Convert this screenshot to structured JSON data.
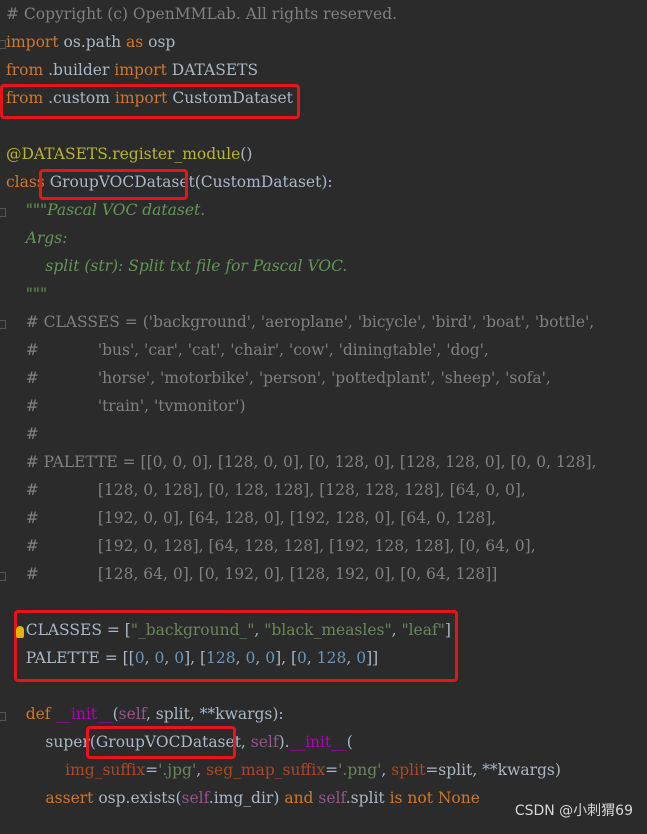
{
  "lines": [
    {
      "segments": [
        {
          "t": "# Copyright (c) OpenMMLab. All rights reserved.",
          "c": "com"
        }
      ]
    },
    {
      "segments": [
        {
          "t": "import",
          "c": "kw"
        },
        {
          "t": " os.path ",
          "c": "txt"
        },
        {
          "t": "as",
          "c": "kw"
        },
        {
          "t": " osp",
          "c": "txt"
        }
      ]
    },
    {
      "segments": [
        {
          "t": "from",
          "c": "kw"
        },
        {
          "t": " .builder ",
          "c": "txt"
        },
        {
          "t": "import",
          "c": "kw"
        },
        {
          "t": " DATASETS",
          "c": "txt"
        }
      ]
    },
    {
      "segments": [
        {
          "t": "from",
          "c": "kw"
        },
        {
          "t": " .custom ",
          "c": "txt"
        },
        {
          "t": "import",
          "c": "kw"
        },
        {
          "t": " CustomDataset",
          "c": "txt"
        }
      ]
    },
    {
      "segments": []
    },
    {
      "segments": [
        {
          "t": "@DATASETS.register_module",
          "c": "dec"
        },
        {
          "t": "()",
          "c": "txt"
        }
      ]
    },
    {
      "segments": [
        {
          "t": "class",
          "c": "kw"
        },
        {
          "t": " GroupVOCDataset",
          "c": "txt"
        },
        {
          "t": "(CustomDataset):",
          "c": "txt"
        }
      ]
    },
    {
      "segments": [
        {
          "t": "    \"\"\"Pascal VOC dataset.",
          "c": "doc"
        }
      ]
    },
    {
      "segments": [
        {
          "t": "    Args:",
          "c": "doc"
        }
      ]
    },
    {
      "segments": [
        {
          "t": "        split (str): Split txt file for Pascal VOC.",
          "c": "doc"
        }
      ]
    },
    {
      "segments": [
        {
          "t": "    \"\"\"",
          "c": "doc"
        }
      ]
    },
    {
      "segments": [
        {
          "t": "    # CLASSES = ('background', 'aeroplane', 'bicycle', 'bird', 'boat', 'bottle',",
          "c": "com"
        }
      ]
    },
    {
      "segments": [
        {
          "t": "    #            'bus', 'car', 'cat', 'chair', 'cow', 'diningtable', 'dog',",
          "c": "com"
        }
      ]
    },
    {
      "segments": [
        {
          "t": "    #            'horse', 'motorbike', 'person', 'pottedplant', 'sheep', 'sofa',",
          "c": "com"
        }
      ]
    },
    {
      "segments": [
        {
          "t": "    #            'train', 'tvmonitor')",
          "c": "com"
        }
      ]
    },
    {
      "segments": [
        {
          "t": "    #",
          "c": "com"
        }
      ]
    },
    {
      "segments": [
        {
          "t": "    # PALETTE = [[0, 0, 0], [128, 0, 0], [0, 128, 0], [128, 128, 0], [0, 0, 128],",
          "c": "com"
        }
      ]
    },
    {
      "segments": [
        {
          "t": "    #            [128, 0, 128], [0, 128, 128], [128, 128, 128], [64, 0, 0],",
          "c": "com"
        }
      ]
    },
    {
      "segments": [
        {
          "t": "    #            [192, 0, 0], [64, 128, 0], [192, 128, 0], [64, 0, 128],",
          "c": "com"
        }
      ]
    },
    {
      "segments": [
        {
          "t": "    #            [192, 0, 128], [64, 128, 128], [192, 128, 128], [0, 64, 0],",
          "c": "com"
        }
      ]
    },
    {
      "segments": [
        {
          "t": "    #            [128, 64, 0], [0, 192, 0], [128, 192, 0], [0, 64, 128]]",
          "c": "com"
        }
      ]
    },
    {
      "segments": []
    },
    {
      "segments": [
        {
          "t": "    CLASSES = [",
          "c": "txt"
        },
        {
          "t": "\"_background_\"",
          "c": "str"
        },
        {
          "t": ", ",
          "c": "txt"
        },
        {
          "t": "\"black_measles\"",
          "c": "str"
        },
        {
          "t": ", ",
          "c": "txt"
        },
        {
          "t": "\"leaf\"",
          "c": "str"
        },
        {
          "t": "]",
          "c": "txt"
        }
      ]
    },
    {
      "segments": [
        {
          "t": "    PALETTE = [[",
          "c": "txt"
        },
        {
          "t": "0",
          "c": "num"
        },
        {
          "t": ", ",
          "c": "txt"
        },
        {
          "t": "0",
          "c": "num"
        },
        {
          "t": ", ",
          "c": "txt"
        },
        {
          "t": "0",
          "c": "num"
        },
        {
          "t": "], [",
          "c": "txt"
        },
        {
          "t": "128",
          "c": "num"
        },
        {
          "t": ", ",
          "c": "txt"
        },
        {
          "t": "0",
          "c": "num"
        },
        {
          "t": ", ",
          "c": "txt"
        },
        {
          "t": "0",
          "c": "num"
        },
        {
          "t": "], [",
          "c": "txt"
        },
        {
          "t": "0",
          "c": "num"
        },
        {
          "t": ", ",
          "c": "txt"
        },
        {
          "t": "128",
          "c": "num"
        },
        {
          "t": ", ",
          "c": "txt"
        },
        {
          "t": "0",
          "c": "num"
        },
        {
          "t": "]]",
          "c": "txt"
        }
      ]
    },
    {
      "segments": []
    },
    {
      "segments": [
        {
          "t": "    def ",
          "c": "kw"
        },
        {
          "t": "__init__",
          "c": "magic"
        },
        {
          "t": "(",
          "c": "txt"
        },
        {
          "t": "self",
          "c": "self"
        },
        {
          "t": ", split, **kwargs):",
          "c": "txt"
        }
      ]
    },
    {
      "segments": [
        {
          "t": "        super",
          "c": "txt"
        },
        {
          "t": "(GroupVOCDataset, ",
          "c": "txt"
        },
        {
          "t": "self",
          "c": "self"
        },
        {
          "t": ").",
          "c": "txt"
        },
        {
          "t": "__init__",
          "c": "magic"
        },
        {
          "t": "(",
          "c": "txt"
        }
      ]
    },
    {
      "segments": [
        {
          "t": "            ",
          "c": "txt"
        },
        {
          "t": "img_suffix",
          "c": "param"
        },
        {
          "t": "=",
          "c": "txt"
        },
        {
          "t": "'.jpg'",
          "c": "str"
        },
        {
          "t": ", ",
          "c": "txt"
        },
        {
          "t": "seg_map_suffix",
          "c": "param"
        },
        {
          "t": "=",
          "c": "txt"
        },
        {
          "t": "'.png'",
          "c": "str"
        },
        {
          "t": ", ",
          "c": "txt"
        },
        {
          "t": "split",
          "c": "param"
        },
        {
          "t": "=split, **kwargs)",
          "c": "txt"
        }
      ]
    },
    {
      "segments": [
        {
          "t": "        assert ",
          "c": "kw"
        },
        {
          "t": "osp.exists(",
          "c": "txt"
        },
        {
          "t": "self",
          "c": "self"
        },
        {
          "t": ".img_dir) ",
          "c": "txt"
        },
        {
          "t": "and ",
          "c": "kw"
        },
        {
          "t": "self",
          "c": "self"
        },
        {
          "t": ".split ",
          "c": "txt"
        },
        {
          "t": "is not None",
          "c": "kw"
        }
      ]
    }
  ],
  "watermark": "CSDN @小刺猬69"
}
